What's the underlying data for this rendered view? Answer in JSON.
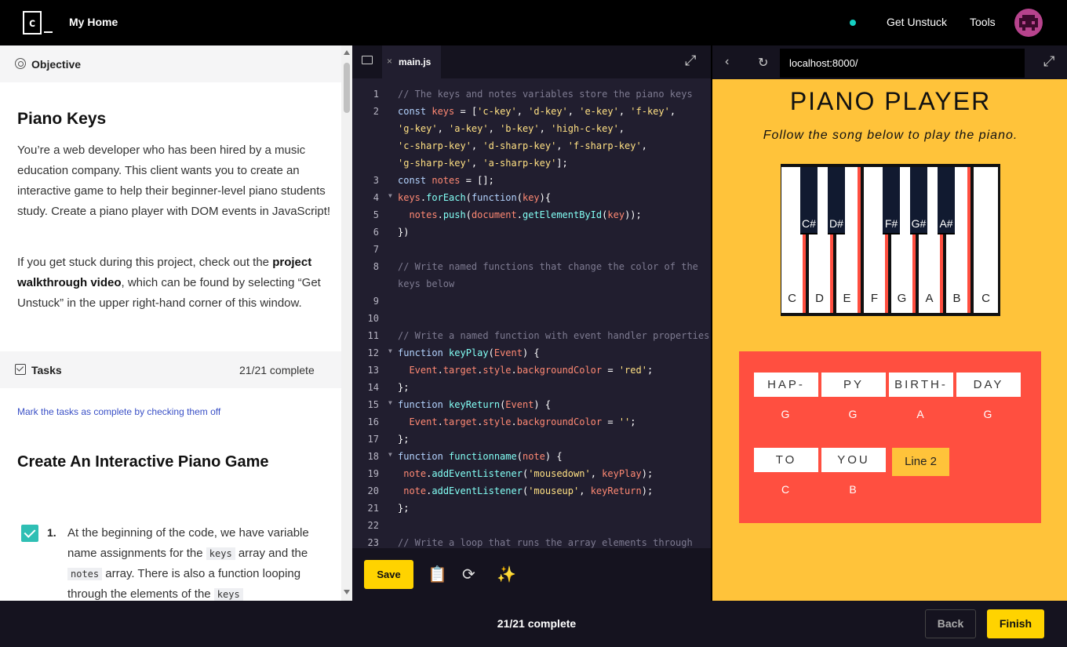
{
  "header": {
    "logo_text": "c",
    "home_label": "My Home",
    "get_unstuck_label": "Get Unstuck",
    "tools_label": "Tools",
    "status_dot_color": "#15d0c2"
  },
  "lesson": {
    "objective_label": "Objective",
    "title": "Piano Keys",
    "intro": "You’re a web developer who has been hired by a music education company. This client wants you to create an interactive game to help their beginner-level piano students study. Create a piano player with DOM events in JavaScript!",
    "stuck_pre": "If you get stuck during this project, check out the ",
    "stuck_bold": "project walkthrough video",
    "stuck_post": ", which can be found by selecting “Get Unstuck” in the upper right-hand corner of this window.",
    "tasks_label": "Tasks",
    "tasks_count": "21/21 complete",
    "mark_hint": "Mark the tasks as complete by checking them off",
    "section_title": "Create An Interactive Piano Game",
    "task1_number": "1.",
    "task1_text_a": "At the beginning of the code, we have variable name assignments for the ",
    "task1_code_a": "keys",
    "task1_text_b": " array and the ",
    "task1_code_b": "notes",
    "task1_text_c": " array. There is also a function looping through the elements of the ",
    "task1_code_c": "keys"
  },
  "editor": {
    "file_tab": "main.js",
    "save_label": "Save",
    "line_numbers": [
      "1",
      "2",
      "",
      "",
      "",
      "3",
      "4",
      "5",
      "6",
      "7",
      "8",
      "",
      "9",
      "10",
      "11",
      "12",
      "13",
      "14",
      "15",
      "16",
      "17",
      "18",
      "19",
      "20",
      "21",
      "22",
      "23"
    ]
  },
  "browser": {
    "url": "localhost:8000/",
    "page_title": "PIANO PLAYER",
    "page_subtitle": "Follow the song below to play the piano.",
    "white_keys": [
      "C",
      "D",
      "E",
      "F",
      "G",
      "A",
      "B",
      "C"
    ],
    "black_keys": [
      "C#",
      "D#",
      "F#",
      "G#",
      "A#"
    ],
    "song_words": [
      "HAP-",
      "PY",
      "BIRTH-",
      "DAY",
      "TO",
      "YOU"
    ],
    "song_notes": [
      "G",
      "G",
      "A",
      "G",
      "C",
      "B"
    ],
    "line2_label": "Line 2",
    "accent_color": "#ffc33a",
    "song_bg_color": "#ff4f40"
  },
  "footer": {
    "progress": "21/21 complete",
    "back_label": "Back",
    "finish_label": "Finish"
  }
}
